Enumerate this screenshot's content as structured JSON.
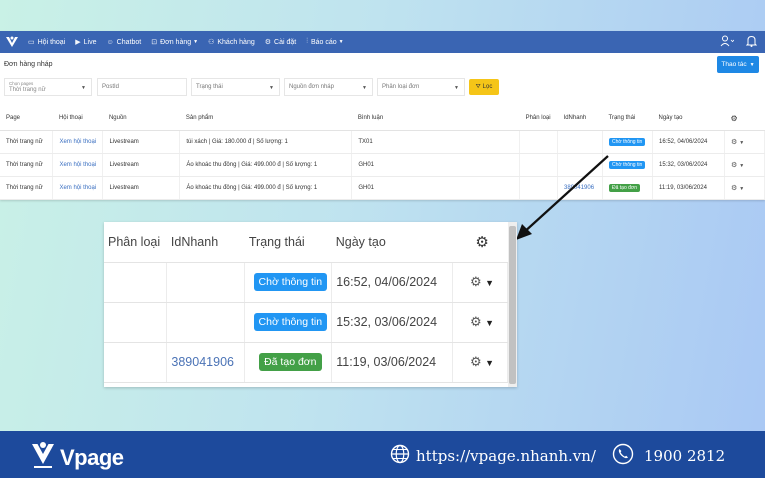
{
  "nav": {
    "items": [
      {
        "icon": "chat-icon",
        "label": "Hội thoại"
      },
      {
        "icon": "video-icon",
        "label": "Live"
      },
      {
        "icon": "bot-icon",
        "label": "Chatbot"
      },
      {
        "icon": "cart-icon",
        "label": "Đơn hàng"
      },
      {
        "icon": "users-icon",
        "label": "Khách hàng"
      },
      {
        "icon": "gear-icon",
        "label": "Cài đặt"
      },
      {
        "icon": "chart-icon",
        "label": "Báo cáo"
      }
    ]
  },
  "page": {
    "title": "Đơn hàng nháp",
    "action_label": "Thao tác"
  },
  "filters": {
    "channel_label": "Chọn pages",
    "channel_value": "Thời trang nữ",
    "postid_placeholder": "PostId",
    "status_placeholder": "Trạng thái",
    "source_placeholder": "Nguồn đơn nháp",
    "category_placeholder": "Phân loại đơn",
    "filter_label": "Lọc"
  },
  "table": {
    "headers": [
      "Page",
      "Hội thoại",
      "Nguồn",
      "Sản phẩm",
      "Bình luận",
      "Phân loại",
      "IdNhanh",
      "Trạng thái",
      "Ngày tạo"
    ],
    "rows": [
      {
        "page": "Thời trang nữ",
        "conv": "Xem hội thoại",
        "source": "Livestream",
        "product": "túi xách | Giá: 180.000 đ | Số lượng: 1",
        "comment": "TX01",
        "category": "",
        "idnhanh": "",
        "status": "Chờ thông tin",
        "status_color": "#2196f3",
        "date": "16:52, 04/06/2024"
      },
      {
        "page": "Thời trang nữ",
        "conv": "Xem hội thoại",
        "source": "Livestream",
        "product": "Áo khoác thu đông | Giá: 499.000 đ | Số lượng: 1",
        "comment": "GH01",
        "category": "",
        "idnhanh": "",
        "status": "Chờ thông tin",
        "status_color": "#2196f3",
        "date": "15:32, 03/06/2024"
      },
      {
        "page": "Thời trang nữ",
        "conv": "Xem hội thoại",
        "source": "Livestream",
        "product": "Áo khoác thu đông | Giá: 499.000 đ | Số lượng: 1",
        "comment": "GH01",
        "category": "",
        "idnhanh": "389041906",
        "status": "Đã tạo đơn",
        "status_color": "#43a047",
        "date": "11:19, 03/06/2024"
      }
    ]
  },
  "zoom": {
    "headers": [
      "Phân loại",
      "IdNhanh",
      "Trạng thái",
      "Ngày tạo"
    ],
    "rows": [
      {
        "category": "",
        "idnhanh": "",
        "status": "Chờ thông tin",
        "date": "16:52, 04/06/2024"
      },
      {
        "category": "",
        "idnhanh": "",
        "status": "Chờ thông tin",
        "date": "15:32, 03/06/2024"
      },
      {
        "category": "",
        "idnhanh": "389041906",
        "status": "Đã tạo đơn",
        "date": "11:19, 03/06/2024"
      }
    ]
  },
  "footer": {
    "brand": "Vpage",
    "url": "https://vpage.nhanh.vn/",
    "phone": "1900 2812"
  },
  "colors": {
    "nav_bg": "#3a65b3",
    "footer_bg": "#1d4a9c",
    "badge_blue": "#2196f3",
    "badge_green": "#43a047",
    "filter_btn": "#f5c518"
  }
}
